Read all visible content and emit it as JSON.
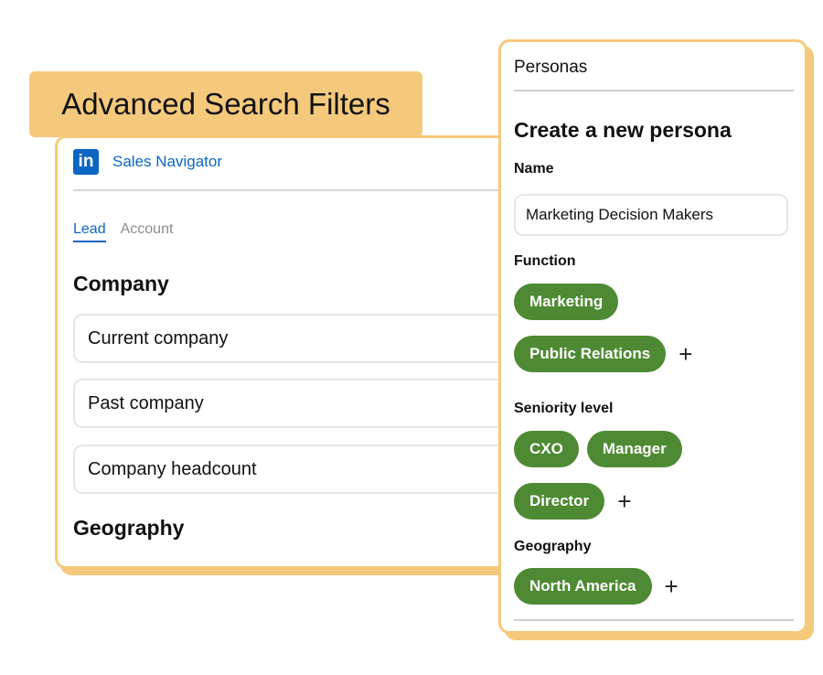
{
  "banner": {
    "title": "Advanced Search Filters"
  },
  "brand": {
    "logo_text": "in",
    "name": "Sales Navigator",
    "logo_color": "#0a66c2"
  },
  "search_tabs": [
    {
      "label": "Lead",
      "active": true
    },
    {
      "label": "Account",
      "active": false
    }
  ],
  "sections": {
    "company": {
      "heading": "Company",
      "filters": [
        "Current company",
        "Past company",
        "Company headcount"
      ]
    },
    "geography": {
      "heading": "Geography"
    }
  },
  "persona_panel": {
    "header": "Personas",
    "create_title": "Create a new persona",
    "name": {
      "label": "Name",
      "value": "Marketing Decision Makers"
    },
    "function": {
      "label": "Function",
      "tags": [
        "Marketing",
        "Public Relations"
      ]
    },
    "seniority": {
      "label": "Seniority level",
      "tags": [
        "CXO",
        "Manager",
        "Director"
      ]
    },
    "geography": {
      "label": "Geography",
      "tags": [
        "North America"
      ]
    },
    "add_symbol": "+"
  },
  "colors": {
    "accent": "#f5c97c",
    "pill": "#4e8a33",
    "link": "#0a66c2"
  },
  "icons": {
    "logo": "linkedin-icon",
    "add": "plus-icon"
  }
}
